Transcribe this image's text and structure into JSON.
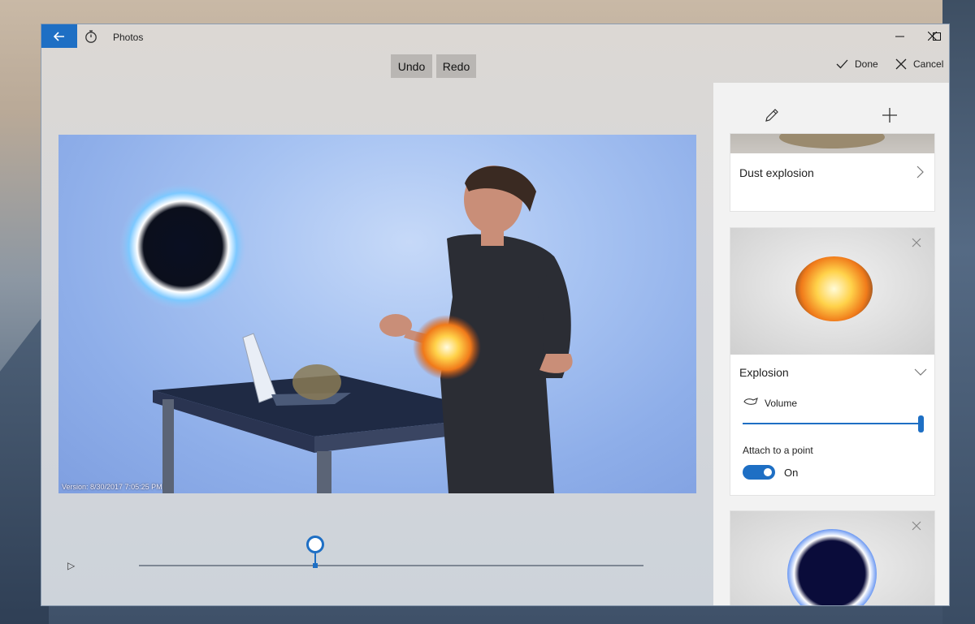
{
  "window": {
    "app_title": "Photos",
    "back_icon": "arrow-left-icon",
    "timer_icon": "timer-icon",
    "minimize_glyph": "—",
    "maximize_glyph": "☐",
    "close_glyph": "✕"
  },
  "toolbar": {
    "undo_label": "Undo",
    "redo_label": "Redo",
    "done_label": "Done",
    "cancel_label": "Cancel"
  },
  "canvas": {
    "version_text": "Version: 8/30/2017 7:05:25 PM"
  },
  "timeline": {
    "play_glyph": "▷",
    "position_fraction": 0.35
  },
  "panel": {
    "edit_icon": "pencil-icon",
    "add_icon": "plus-icon",
    "effects": [
      {
        "name": "Dust explosion",
        "state": "collapsed"
      },
      {
        "name": "Explosion",
        "state": "expanded",
        "volume_label": "Volume",
        "volume_level": 1.0,
        "attach_label": "Attach to a point",
        "attach_state": "On"
      },
      {
        "name": "",
        "state": "thumbnail-only"
      }
    ]
  },
  "colors": {
    "accent": "#1e6fc4",
    "panel_bg": "#f2f2f2",
    "canvas_bg": "#a7c3f2"
  }
}
